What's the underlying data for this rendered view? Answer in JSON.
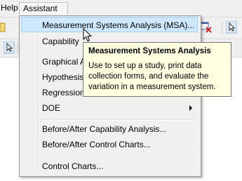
{
  "menubar": {
    "help": "Help",
    "assistant": "Assistant"
  },
  "menu": {
    "items": [
      {
        "label": "Measurement Systems Analysis (MSA)...",
        "highlighted": true
      },
      {
        "label": "Capability"
      },
      {
        "label": "Graphical A"
      },
      {
        "label": "Hypothesis"
      },
      {
        "label": "Regression"
      },
      {
        "label": "DOE",
        "submenu": true
      },
      {
        "label": "Before/After Capability Analysis..."
      },
      {
        "label": "Before/After Control Charts..."
      },
      {
        "label": "Control Charts..."
      }
    ]
  },
  "tooltip": {
    "title": "Measurement Systems Analysis",
    "body": "Use to set up a study, print data collection forms, and evaluate the variation in a measurement system."
  },
  "colors": {
    "highlight": "#cde8ff",
    "tooltip_bg": "#ffffe1",
    "menu_bg": "#f0f0f0"
  }
}
